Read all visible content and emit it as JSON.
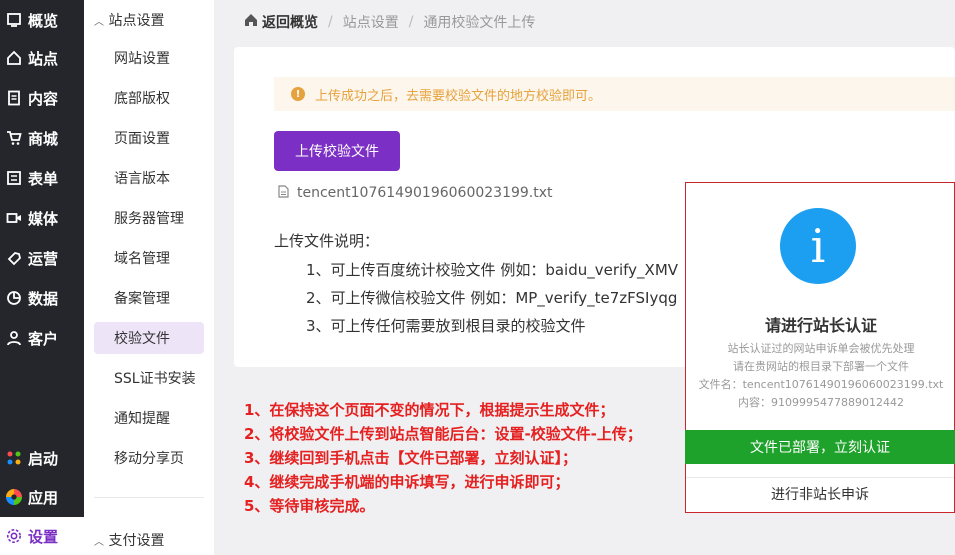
{
  "nav": {
    "items": [
      {
        "icon": "overview-icon",
        "label": "概览"
      },
      {
        "icon": "home-icon",
        "label": "站点"
      },
      {
        "icon": "document-icon",
        "label": "内容"
      },
      {
        "icon": "cart-icon",
        "label": "商城"
      },
      {
        "icon": "form-icon",
        "label": "表单"
      },
      {
        "icon": "video-icon",
        "label": "媒体"
      },
      {
        "icon": "tag-icon",
        "label": "运营"
      },
      {
        "icon": "chart-icon",
        "label": "数据"
      },
      {
        "icon": "user-icon",
        "label": "客户"
      }
    ],
    "launch_label": "启动",
    "apps_label": "应用",
    "settings_label": "设置"
  },
  "subnav": {
    "group_title": "站点设置",
    "items": [
      "网站设置",
      "底部版权",
      "页面设置",
      "语言版本",
      "服务器管理",
      "域名管理",
      "备案管理",
      "校验文件",
      "SSL证书安装",
      "通知提醒",
      "移动分享页"
    ],
    "active_index": 7,
    "bottom_group": "支付设置"
  },
  "breadcrumb": {
    "home": "返回概览",
    "level1": "站点设置",
    "level2": "通用校验文件上传"
  },
  "alert": {
    "text": "上传成功之后，去需要校验文件的地方校验即可。"
  },
  "upload_button": "上传校验文件",
  "uploaded_file": "tencent10761490196060023199.txt",
  "desc": {
    "title": "上传文件说明：",
    "items": [
      "1、可上传百度统计校验文件 例如：baidu_verify_XMV",
      "2、可上传微信校验文件 例如：MP_verify_te7zFSIyqg",
      "3、可上传任何需要放到根目录的校验文件"
    ]
  },
  "steps": [
    "1、在保持这个页面不变的情况下，根据提示生成文件；",
    "2、将校验文件上传到站点智能后台：设置-校验文件-上传；",
    "3、继续回到手机点击【文件已部署，立刻认证】；",
    "4、继续完成手机端的申诉填写，进行申诉即可；",
    "5、等待审核完成。"
  ],
  "modal": {
    "icon": "info-icon",
    "icon_glyph": "i",
    "title": "请进行站长认证",
    "line1": "站长认证过的网站申诉单会被优先处理",
    "line2": "请在贵网站的根目录下部署一个文件",
    "line3": "文件名：tencent10761490196060023199.txt",
    "line4": "内容：9109995477889012442",
    "confirm": "文件已部署，立刻认证",
    "appeal": "进行非站长申诉"
  },
  "colors": {
    "accent": "#7b2fc5",
    "confirm": "#1fa22b",
    "info": "#1d9ff1",
    "warning": "#e6a23c",
    "annotation": "#e52020"
  }
}
